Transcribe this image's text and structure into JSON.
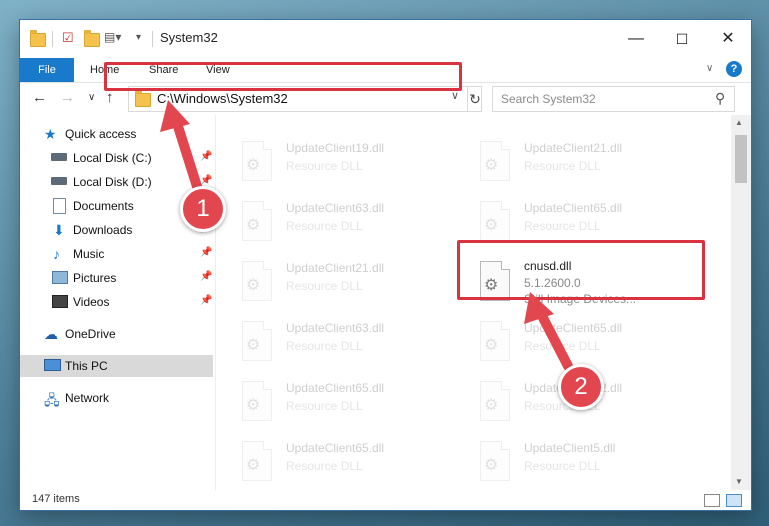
{
  "window": {
    "title": "System32",
    "controls": {
      "minimize": "—",
      "maximize": "☐",
      "close": "✕"
    }
  },
  "ribbon": {
    "tabs": [
      "File",
      "Home",
      "Share",
      "View"
    ],
    "help": "?"
  },
  "address": {
    "path": "C:\\Windows\\System32",
    "search_placeholder": "Search System32"
  },
  "sidebar": {
    "items": [
      {
        "label": "Quick access",
        "icon": "star-icon"
      },
      {
        "label": "Local Disk (C:)",
        "icon": "drive-icon"
      },
      {
        "label": "Local Disk (D:)",
        "icon": "drive-icon"
      },
      {
        "label": "Documents",
        "icon": "documents-icon"
      },
      {
        "label": "Downloads",
        "icon": "download-icon"
      },
      {
        "label": "Music",
        "icon": "music-icon"
      },
      {
        "label": "Pictures",
        "icon": "pictures-icon"
      },
      {
        "label": "Videos",
        "icon": "videos-icon"
      },
      {
        "label": "OneDrive",
        "icon": "cloud-icon"
      },
      {
        "label": "This PC",
        "icon": "computer-icon"
      },
      {
        "label": "Network",
        "icon": "network-icon"
      }
    ]
  },
  "files": [
    {
      "name": "UpdateClient19.dll",
      "sub": "Resource DLL"
    },
    {
      "name": "UpdateClient21.dll",
      "sub": "Resource DLL"
    },
    {
      "name": "UpdateClient63.dll",
      "sub": "Resource DLL"
    },
    {
      "name": "UpdateClient65.dll",
      "sub": "Resource DLL"
    },
    {
      "name": "UpdateClient21.dll",
      "sub": "Resource DLL"
    },
    {
      "name": "cnusd.dll",
      "sub": "5.1.2600.0",
      "sub2": "Still Image Devices..."
    },
    {
      "name": "UpdateClient63.dll",
      "sub": "Resource DLL"
    },
    {
      "name": "UpdateClient65.dll",
      "sub": "Resource DLL"
    },
    {
      "name": "UpdateClient65.dll",
      "sub": "Resource DLL"
    },
    {
      "name": "UpdateClient42.dll",
      "sub": "Resource DLL"
    },
    {
      "name": "UpdateClient65.dll",
      "sub": "Resource DLL"
    },
    {
      "name": "UpdateClient5.dll",
      "sub": "Resource DLL"
    }
  ],
  "status": {
    "items": "147 items"
  },
  "annotations": {
    "step1": "1",
    "step2": "2"
  },
  "colors": {
    "accent": "#1979ca",
    "highlight": "#d9333f",
    "badge": "#e2474f"
  }
}
